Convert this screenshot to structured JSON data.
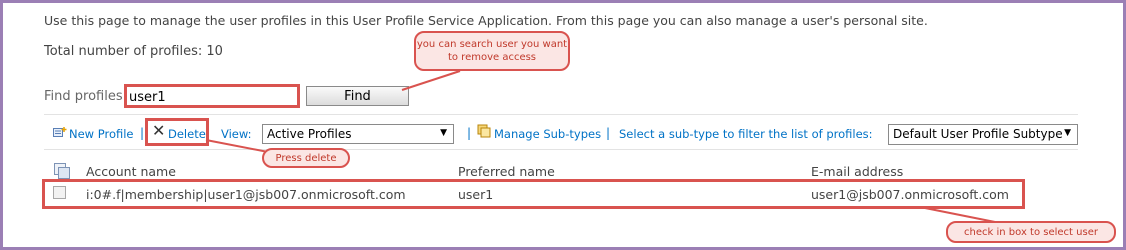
{
  "intro_text": "Use this page to manage the user profiles in this User Profile Service Application. From this page you can also manage a user's personal site.",
  "total_profiles": "Total number of profiles: 10",
  "search": {
    "label": "Find profiles",
    "value": "user1",
    "button_label": "Find"
  },
  "toolbar": {
    "new_profile_label": "New Profile",
    "separator": "|",
    "delete_label": "Delete",
    "view_label": "View:",
    "view_selected": "Active Profiles",
    "manage_subtypes_label": "Manage Sub-types",
    "subtype_prompt": "Select a sub-type to filter the list of profiles:",
    "subtype_selected": "Default User Profile Subtype"
  },
  "table": {
    "columns": [
      "Account name",
      "Preferred name",
      "E-mail address"
    ],
    "rows": [
      {
        "account": "i:0#.f|membership|user1@jsb007.onmicrosoft.com",
        "preferred": "user1",
        "email": "user1@jsb007.onmicrosoft.com"
      }
    ]
  },
  "annotations": {
    "search_note": "you can search user you want to remove access",
    "delete_note": "Press delete",
    "check_note": "check in box to select user"
  },
  "colors": {
    "link_blue": "#0072c6",
    "annotation_red": "#d9534f",
    "frame_purple": "#9b7fb5"
  }
}
